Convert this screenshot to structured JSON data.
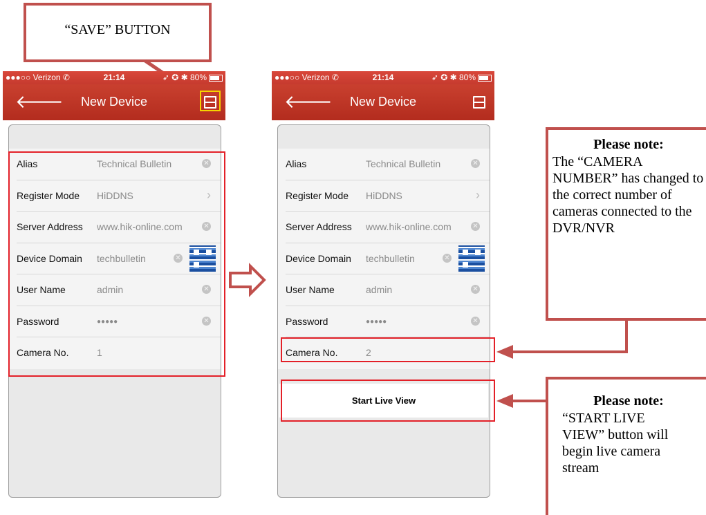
{
  "callouts": {
    "save_button": "“SAVE” BUTTON",
    "camera_note_title": "Please note:",
    "camera_note_body": "The “CAMERA NUMBER” has changed to the correct number of cameras connected to the DVR/NVR",
    "liveview_note_title": "Please note:",
    "liveview_note_body": "“START LIVE VIEW” button will begin live camera stream"
  },
  "status": {
    "carrier": "●●●○○ Verizon ✆",
    "time": "21:14",
    "right": "➶ ✪ ✱ 80%"
  },
  "nav": {
    "back": "🡐",
    "title": "New Device"
  },
  "phones": [
    {
      "fields": [
        {
          "label": "Alias",
          "value": "Technical Bulletin"
        },
        {
          "label": "Register Mode",
          "value": "HiDDNS"
        },
        {
          "label": "Server Address",
          "value": "www.hik-online.com"
        },
        {
          "label": "Device Domain",
          "value": "techbulletin"
        },
        {
          "label": "User Name",
          "value": "admin"
        },
        {
          "label": "Password",
          "value": "●●●●●"
        },
        {
          "label": "Camera No.",
          "value": "1"
        }
      ]
    },
    {
      "fields": [
        {
          "label": "Alias",
          "value": "Technical Bulletin"
        },
        {
          "label": "Register Mode",
          "value": "HiDDNS"
        },
        {
          "label": "Server Address",
          "value": "www.hik-online.com"
        },
        {
          "label": "Device Domain",
          "value": "techbulletin"
        },
        {
          "label": "User Name",
          "value": "admin"
        },
        {
          "label": "Password",
          "value": "●●●●●"
        },
        {
          "label": "Camera No.",
          "value": "2"
        }
      ],
      "start_live_view": "Start Live View"
    }
  ],
  "colors": {
    "header_red": "#c9402f",
    "highlight_red": "#e32028",
    "callout_red": "#c0504d",
    "save_yellow": "#f5d400"
  },
  "clear_glyph": "✕",
  "chevron_glyph": "›"
}
